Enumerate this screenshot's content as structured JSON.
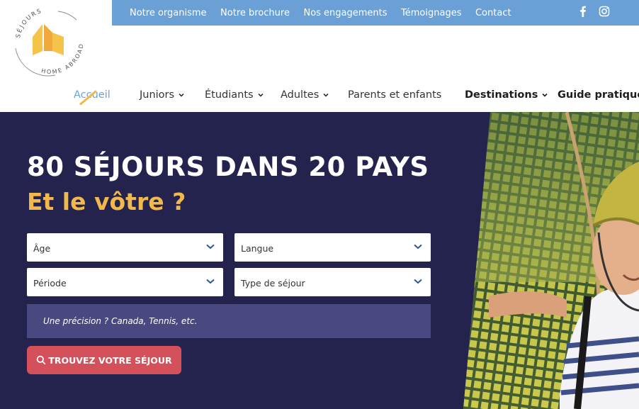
{
  "top_links": [
    "Notre organisme",
    "Notre brochure",
    "Nos engagements",
    "Témoignages",
    "Contact"
  ],
  "social": {
    "facebook_icon": "facebook-icon",
    "instagram_icon": "instagram-icon"
  },
  "logo": {
    "top_text": "SÉJOURS",
    "bottom_text": "HOME ABROAD"
  },
  "nav": {
    "home": "Accueil",
    "juniors": "Juniors",
    "students": "Étudiants",
    "adults": "Adultes",
    "parents": "Parents et enfants",
    "destinations": "Destinations",
    "guide": "Guide pratique"
  },
  "hero": {
    "title": "80 SÉJOURS DANS 20 PAYS",
    "subtitle": "Et le vôtre ?",
    "age_label": "Âge",
    "language_label": "Langue",
    "period_label": "Période",
    "stay_type_label": "Type de séjour",
    "precision_placeholder": "Une précision ? Canada, Tennis, etc.",
    "cta_label": "TROUVEZ VOTRE SÉJOUR"
  },
  "colors": {
    "accent_yellow": "#f2b84b",
    "topbar_blue": "#6aa0d6",
    "hero_navy": "#24234e",
    "cta_red": "#d4505a"
  }
}
